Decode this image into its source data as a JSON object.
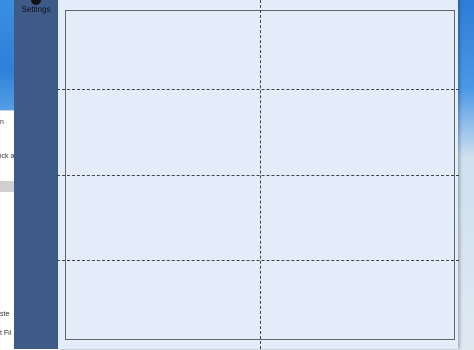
{
  "sidebar": {
    "settings_label": "Settings",
    "settings_icon": "gear-icon"
  },
  "background_window": {
    "snippet_1": "n",
    "snippet_2": "ick a",
    "snippet_3": "ste",
    "snippet_4": "t Fil"
  },
  "colors": {
    "sidebar": "#3d5a88",
    "panel": "#e3edf9",
    "grid_lines": "#444444"
  },
  "grid": {
    "rows": 4,
    "columns": 2
  }
}
